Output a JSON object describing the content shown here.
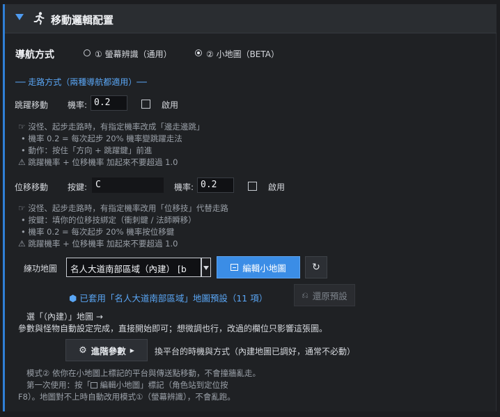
{
  "header": {
    "title": "移動邏輯配置",
    "icon": "running-person-icon"
  },
  "nav_mode": {
    "label": "導航方式",
    "options": [
      {
        "label": "① 螢幕辨識（通用）",
        "selected": false
      },
      {
        "label": "② 小地圖（BETA）",
        "selected": true
      }
    ]
  },
  "walk_section": {
    "title": "── 走路方式（兩種導航都適用）──"
  },
  "jump": {
    "label": "跳躍移動",
    "rate_label": "機率:",
    "rate_value": "0.2",
    "enable_label": "啟用",
    "enabled": false,
    "hints": [
      "沒怪、起步走路時，有指定機率改成「邊走邊跳」",
      "• 機率 0.2 = 每次起步 20% 機率變跳躍走法",
      "• 動作：按住「方向 + 跳躍鍵」前進",
      "跳躍機率 + 位移機率 加起來不要超過 1.0"
    ]
  },
  "displace": {
    "label": "位移移動",
    "key_label": "按鍵:",
    "key_value": "C",
    "rate_label": "機率:",
    "rate_value": "0.2",
    "enable_label": "啟用",
    "enabled": false,
    "hints": [
      "沒怪、起步走路時，有指定機率改用「位移技」代替走路",
      "• 按鍵：填你的位移技綁定（衝刺鍵 / 法師瞬移）",
      "• 機率 0.2 = 每次起步 20% 機率按位移鍵",
      "跳躍機率 + 位移機率 加起來不要超過 1.0"
    ]
  },
  "map": {
    "label": "練功地圖",
    "selected": "名人大道南部區域（內建）  [b",
    "edit_button": "編輯小地圖",
    "applied_text": "已套用「名人大道南部區域」地圖預設（11 項）",
    "restore_button": "還原預設"
  },
  "info": {
    "line1": "選「（內建）」地圖 →",
    "line2": "參數與怪物自動設定完成，直接開始即可；想微調也行，改過的欄位只影響這張圖。"
  },
  "advanced": {
    "button": "進階參數",
    "desc": "換平台的時機與方式（內建地圖已調好，通常不必動）"
  },
  "footer": {
    "line1": "模式② 依你在小地圖上標記的平台與傳送點移動，不會撞牆亂走。",
    "line2": "第一次使用：按「",
    "line2b": " 編輯小地圖」標記（角色站到定位按",
    "line3": "F8）。地圖對不上時自動改用模式①（螢幕辨識），不會亂跑。"
  }
}
